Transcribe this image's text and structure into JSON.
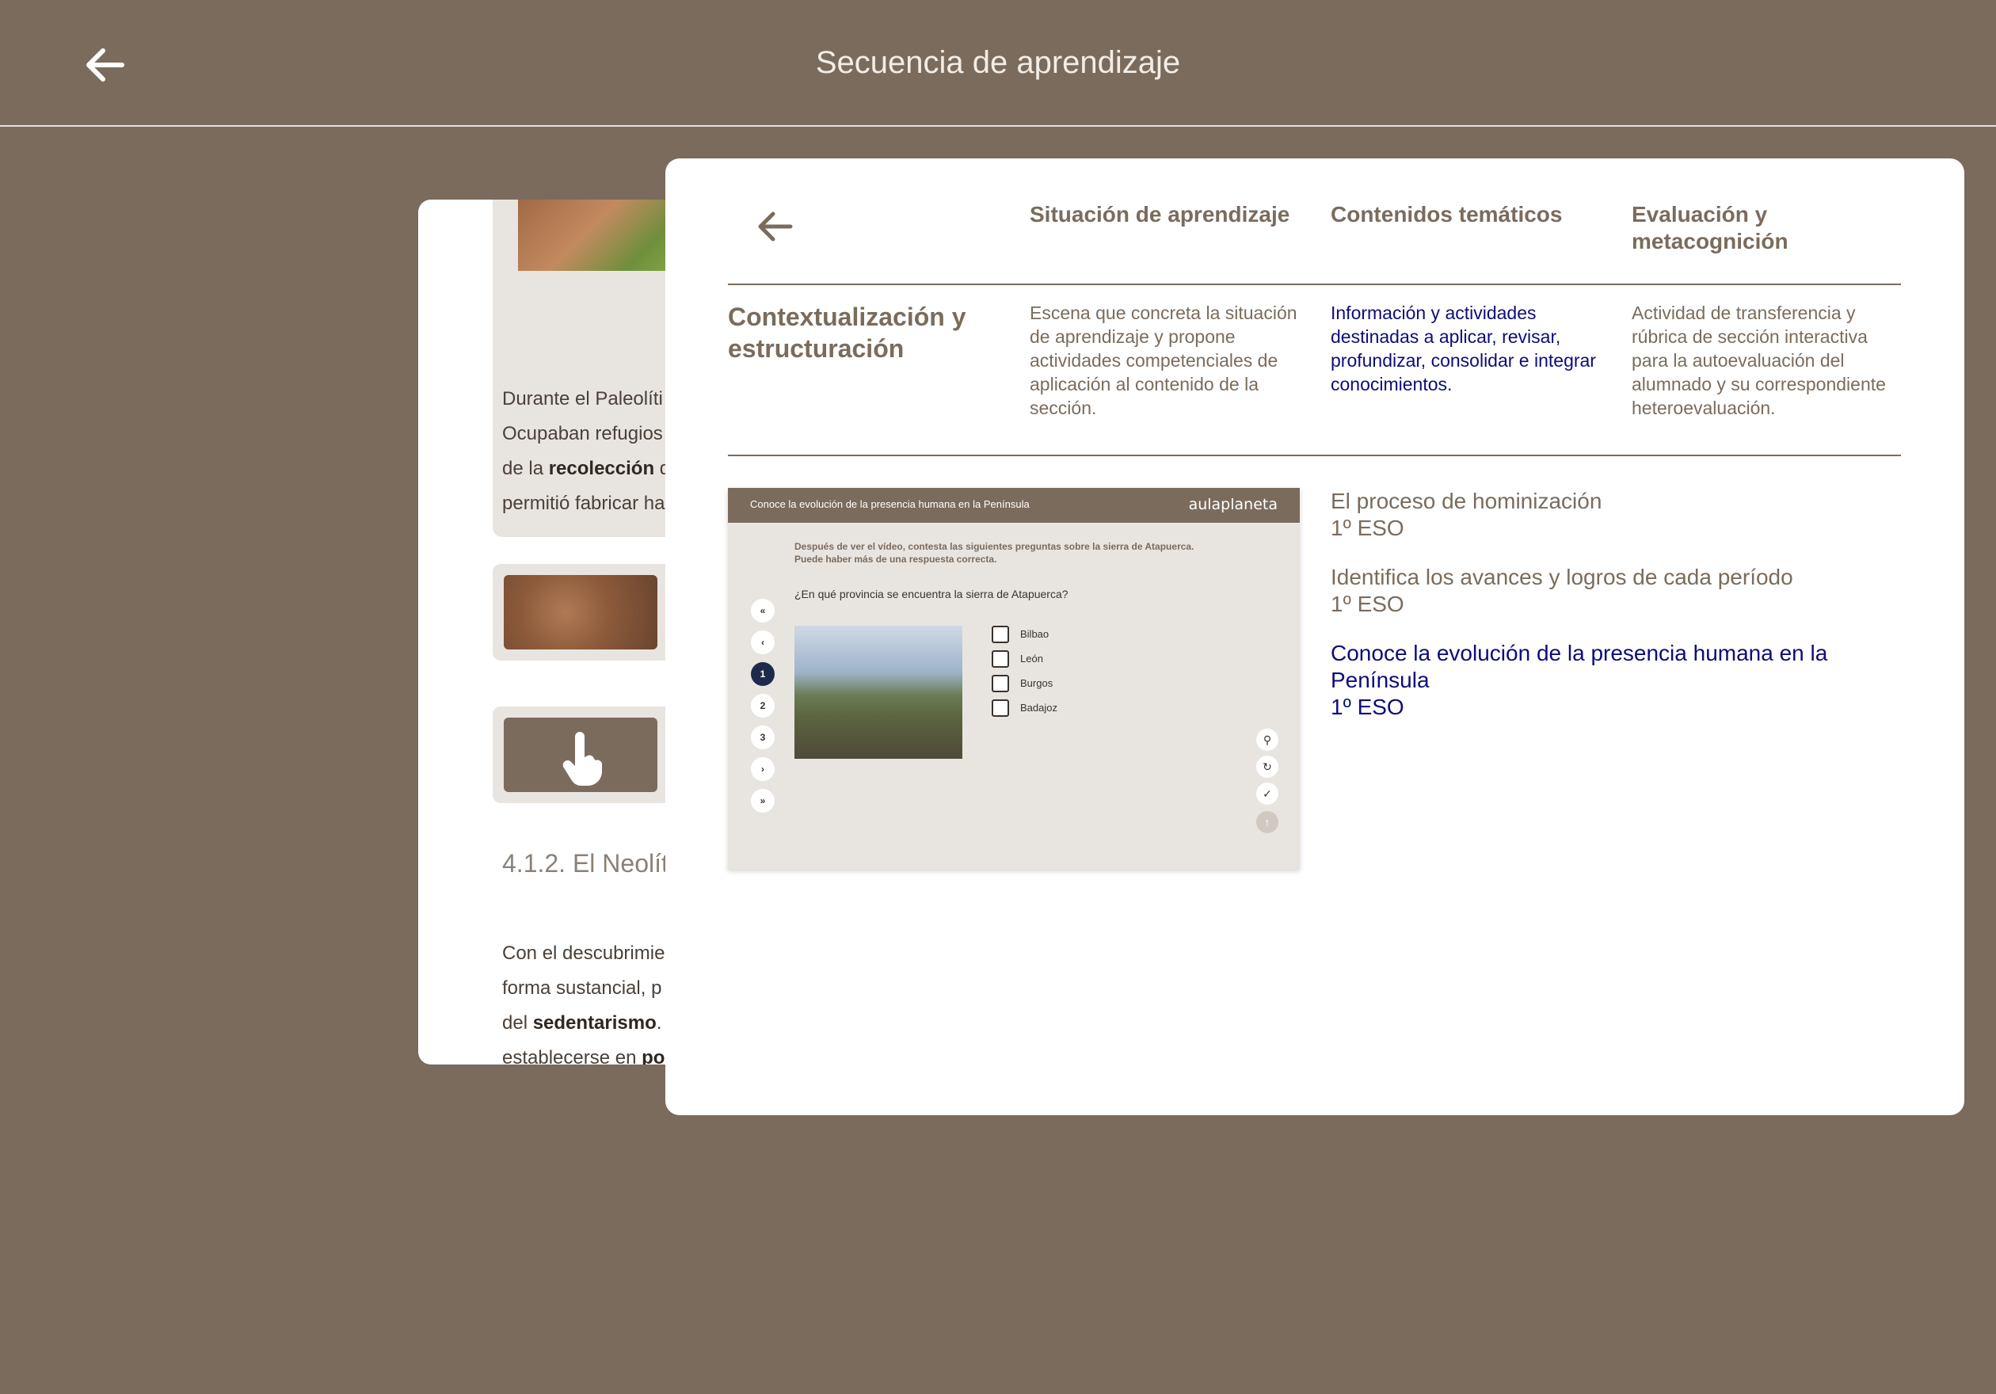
{
  "header": {
    "title": "Secuencia de aprendizaje"
  },
  "document": {
    "lines": [
      {
        "parts": [
          {
            "t": "Durante el Paleolíti",
            "b": false
          }
        ]
      },
      {
        "parts": [
          {
            "t": "Ocupaban refugios",
            "b": false
          }
        ]
      },
      {
        "parts": [
          {
            "t": "de la ",
            "b": false
          },
          {
            "t": "recolección",
            "b": true
          },
          {
            "t": " d",
            "b": false
          }
        ]
      },
      {
        "parts": [
          {
            "t": "permitió fabricar ha",
            "b": false
          }
        ]
      }
    ],
    "heading": "4.1.2. El Neolít",
    "lines2": [
      {
        "parts": [
          {
            "t": "Con el descubrimie",
            "b": false
          }
        ]
      },
      {
        "parts": [
          {
            "t": "forma sustancial, p",
            "b": false
          }
        ]
      },
      {
        "parts": [
          {
            "t": "del ",
            "b": false
          },
          {
            "t": "sedentarismo",
            "b": true
          },
          {
            "t": ". A",
            "b": false
          }
        ]
      },
      {
        "parts": [
          {
            "t": "establecerse en ",
            "b": false
          },
          {
            "t": "po",
            "b": true
          }
        ]
      }
    ]
  },
  "modal": {
    "columns": [
      {
        "title": "Situación de aprendizaje",
        "description": "Escena que concreta la situación de aprendizaje y propone actividades competenciales de aplicación al contenido de la sección.",
        "color": "#7b6b5c"
      },
      {
        "title": "Contenidos temáticos",
        "description": "Información y actividades destinadas a aplicar, revisar, profundizar, consolidar e integrar conocimientos.",
        "color": "#0d0d7a"
      },
      {
        "title": "Evaluación y metacognición",
        "description": "Actividad de transferencia y rúbrica de sección interactiva para la autoevaluación del alumnado y su correspondiente heteroevaluación.",
        "color": "#7b6b5c"
      }
    ],
    "row_title": "Contextualización y estructuración",
    "activity": {
      "title": "Conoce la evolución de la presencia humana en la Península",
      "logo": "aulaplaneta",
      "instructions_1": "Después de ver el vídeo, contesta las siguientes preguntas sobre la sierra de Atapuerca.",
      "instructions_2": "Puede haber más de una respuesta correcta.",
      "question": "¿En qué provincia se encuentra la sierra de Atapuerca?",
      "nav": [
        "«",
        "‹",
        "1",
        "2",
        "3",
        "›",
        "»"
      ],
      "current_index": 2,
      "options": [
        "Bilbao",
        "León",
        "Burgos",
        "Badajoz"
      ],
      "tools": [
        "lightbulb-icon",
        "reset-icon",
        "check-icon",
        "upload-icon"
      ]
    },
    "resources": [
      {
        "title": "El proceso de hominización",
        "level": "1º ESO",
        "color": "#7b6b5c"
      },
      {
        "title": "Identifica los avances y logros de cada período",
        "level": "1º ESO",
        "color": "#7b6b5c"
      },
      {
        "title": "Conoce la evolución de la presencia humana en la Península",
        "level": "1º ESO",
        "color": "#0d0d7a"
      }
    ]
  }
}
